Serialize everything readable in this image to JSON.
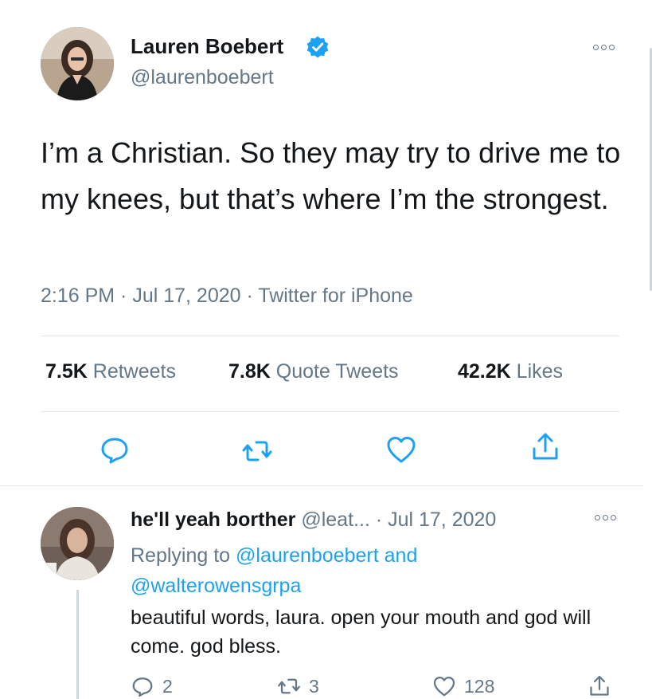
{
  "main_tweet": {
    "author_name": "Lauren Boebert",
    "verified": true,
    "handle": "@laurenboebert",
    "text": "I’m a Christian. So they may try to drive me to my knees, but that’s where I’m the strongest.",
    "meta": "2:16 PM · Jul 17, 2020 · Twitter for iPhone",
    "stats": {
      "retweets_count": "7.5K",
      "retweets_label": "Retweets",
      "quotes_count": "7.8K",
      "quotes_label": "Quote Tweets",
      "likes_count": "42.2K",
      "likes_label": "Likes"
    }
  },
  "reply": {
    "author_name": "he'll yeah borther",
    "handle": "@leat...",
    "date": "· Jul 17, 2020",
    "replying_prefix": "Replying to",
    "mention_1": "@laurenboebert",
    "and_word": "and",
    "mention_2": "@walterowensgrpa",
    "text": "beautiful words, laura. open your mouth and god will come. god bless.",
    "reply_count": "2",
    "retweet_count": "3",
    "like_count": "128"
  },
  "colors": {
    "accent": "#1da1f2",
    "secondary_text": "#657786",
    "primary_text": "#14171a",
    "divider": "#e1e8ed"
  },
  "icons": {
    "verified": "verified-badge-icon",
    "more": "more-options-icon",
    "reply": "reply-icon",
    "retweet": "retweet-icon",
    "like": "heart-icon",
    "share": "share-icon"
  }
}
